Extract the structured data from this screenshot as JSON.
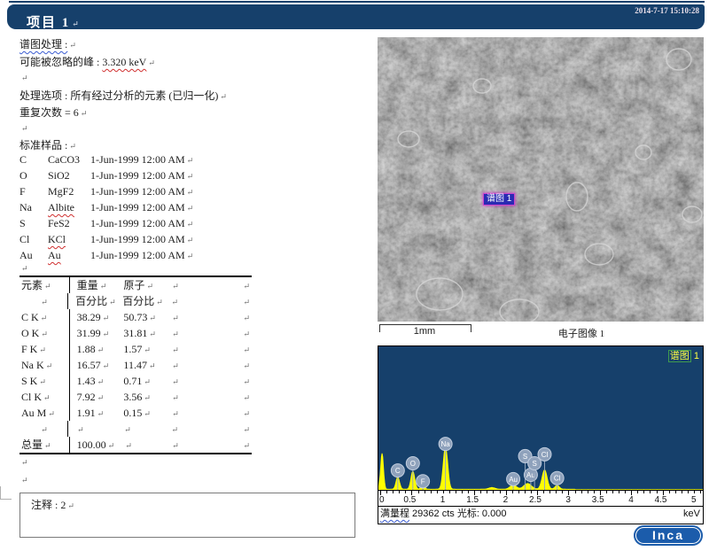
{
  "header": {
    "title": "项目 1",
    "timestamp": "2014-7-17 15:10:28",
    "bar_color": "#16406b"
  },
  "marks": {
    "pilcrow": "↵"
  },
  "processing": {
    "spectrum_processing_label": "谱图处理 :",
    "omitted_peak_label": "可能被忽略的峰 : ",
    "omitted_peak_value": "3.320 keV",
    "options_line": "处理选项 : 所有经过分析的元素 (已归一化)",
    "iterations_line": "重复次数 = 6"
  },
  "standards": {
    "title": "标准样品 :",
    "items": [
      {
        "element": "C",
        "standard": "CaCO3",
        "date": "1-Jun-1999 12:00 AM",
        "misspell": false
      },
      {
        "element": "O",
        "standard": "SiO2",
        "date": "1-Jun-1999 12:00 AM",
        "misspell": false
      },
      {
        "element": "F",
        "standard": "MgF2",
        "date": "1-Jun-1999 12:00 AM",
        "misspell": false
      },
      {
        "element": "Na",
        "standard": "Albite",
        "date": "1-Jun-1999 12:00 AM",
        "misspell": true
      },
      {
        "element": "S",
        "standard": "FeS2",
        "date": "1-Jun-1999 12:00 AM",
        "misspell": false
      },
      {
        "element": "Cl",
        "standard": "KCl",
        "date": "1-Jun-1999 12:00 AM",
        "misspell": true
      },
      {
        "element": "Au",
        "standard": "Au",
        "date": "1-Jun-1999 12:00 AM",
        "misspell": true
      }
    ]
  },
  "results_table": {
    "headers_row1": [
      "元素",
      "重量",
      "原子",
      "",
      ""
    ],
    "headers_row2": [
      "",
      "百分比",
      "百分比",
      "",
      ""
    ],
    "rows": [
      {
        "element": "C K",
        "weight_pct": "38.29",
        "atomic_pct": "50.73"
      },
      {
        "element": "O K",
        "weight_pct": "31.99",
        "atomic_pct": "31.81"
      },
      {
        "element": "F K",
        "weight_pct": "1.88",
        "atomic_pct": "1.57"
      },
      {
        "element": "Na K",
        "weight_pct": "16.57",
        "atomic_pct": "11.47"
      },
      {
        "element": "S K",
        "weight_pct": "1.43",
        "atomic_pct": "0.71"
      },
      {
        "element": "Cl K",
        "weight_pct": "7.92",
        "atomic_pct": "3.56"
      },
      {
        "element": "Au M",
        "weight_pct": "1.91",
        "atomic_pct": "0.15"
      }
    ],
    "total_label": "总量",
    "total_value": "100.00"
  },
  "sem": {
    "marker_label": "谱图 1",
    "scale_text": "1mm",
    "caption": "电子图像 1"
  },
  "spectrum_panel": {
    "legend_boxed": "谱图",
    "legend_number": " 1",
    "status_word": "满量程",
    "status_rest": " 29362 cts 光标: 0.000",
    "kev_label": "keV"
  },
  "chart_data": {
    "type": "area",
    "title": "谱图 1",
    "xlabel": "keV",
    "xlim": [
      0,
      5.2
    ],
    "x_ticks": [
      0,
      0.5,
      1,
      1.5,
      2,
      2.5,
      3,
      3.5,
      4,
      4.5,
      5
    ],
    "full_scale_counts": 29362,
    "cursor_kev": "0.000",
    "peak_color": "#ffff00",
    "bg_color": "#16406b",
    "grid": false,
    "peaks": [
      {
        "element": "",
        "kev": 0.03,
        "rel_h": 0.25,
        "sigma": 0.022
      },
      {
        "element": "C",
        "kev": 0.28,
        "rel_h": 0.085,
        "sigma": 0.028
      },
      {
        "element": "O",
        "kev": 0.52,
        "rel_h": 0.125,
        "sigma": 0.03
      },
      {
        "element": "F",
        "kev": 0.68,
        "rel_h": 0.045,
        "sigma": 0.025
      },
      {
        "element": "Na",
        "kev": 1.04,
        "rel_h": 0.295,
        "sigma": 0.035
      },
      {
        "element": "",
        "kev": 1.78,
        "rel_h": 0.012,
        "sigma": 0.05
      },
      {
        "element": "Au",
        "kev": 2.12,
        "rel_h": 0.03,
        "sigma": 0.05
      },
      {
        "element": "Au",
        "kev": 2.35,
        "rel_h": 0.04,
        "sigma": 0.06
      },
      {
        "element": "Cl",
        "kev": 2.62,
        "rel_h": 0.135,
        "sigma": 0.04
      },
      {
        "element": "Cl",
        "kev": 2.82,
        "rel_h": 0.026,
        "sigma": 0.035
      }
    ],
    "labels": [
      {
        "text": "C",
        "kev": 0.28,
        "yf": 0.865
      },
      {
        "text": "O",
        "kev": 0.52,
        "yf": 0.815
      },
      {
        "text": "F",
        "kev": 0.68,
        "yf": 0.94
      },
      {
        "text": "Na",
        "kev": 1.04,
        "yf": 0.68
      },
      {
        "text": "Au",
        "kev": 2.12,
        "yf": 0.925
      },
      {
        "text": "S",
        "kev": 2.31,
        "yf": 0.765
      },
      {
        "text": "Au",
        "kev": 2.4,
        "yf": 0.895
      },
      {
        "text": "S",
        "kev": 2.46,
        "yf": 0.815
      },
      {
        "text": "Cl",
        "kev": 2.62,
        "yf": 0.752
      },
      {
        "text": "Cl",
        "kev": 2.82,
        "yf": 0.918
      }
    ]
  },
  "annotation": {
    "label": "注释 : 2"
  },
  "logo": {
    "text": "Inca"
  }
}
